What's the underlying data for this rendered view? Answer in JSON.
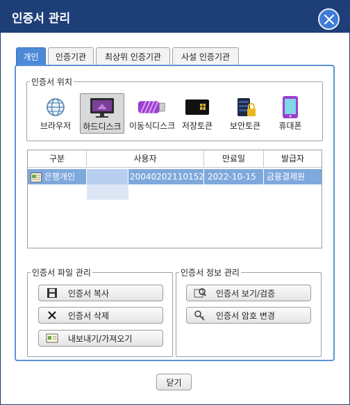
{
  "window": {
    "title": "인증서 관리",
    "close_label": "×"
  },
  "tabs": [
    {
      "label": "개인",
      "active": true
    },
    {
      "label": "인증기관"
    },
    {
      "label": "최상위 인증기관"
    },
    {
      "label": "사설 인증기관"
    }
  ],
  "location": {
    "legend": "인증서 위치",
    "items": [
      {
        "label": "브라우저",
        "icon": "globe-icon"
      },
      {
        "label": "하드디스크",
        "icon": "monitor-icon",
        "selected": true
      },
      {
        "label": "이동식디스크",
        "icon": "usb-drive-icon"
      },
      {
        "label": "저장토큰",
        "icon": "token-icon"
      },
      {
        "label": "보안토큰",
        "icon": "secure-token-icon"
      },
      {
        "label": "휴대폰",
        "icon": "phone-icon"
      }
    ]
  },
  "certs": {
    "headers": [
      "구분",
      "사용자",
      "만료일",
      "발급자"
    ],
    "rows": [
      {
        "type": "은행개인",
        "user": "",
        "serial": "20040202110152...",
        "expiry": "2022-10-15",
        "issuer": "금융결제원"
      }
    ]
  },
  "file_mgmt": {
    "legend": "인증서 파일 관리",
    "copy": "인증서 복사",
    "delete": "인증서 삭제",
    "export": "내보내기/가져오기"
  },
  "info_mgmt": {
    "legend": "인증서 정보 관리",
    "view": "인증서 보기/검증",
    "password": "인증서 암호 변경"
  },
  "footer": {
    "close": "닫기"
  },
  "colors": {
    "titlebar": "#1e3e78",
    "tab_active": "#4c8ad9",
    "row_selected": "#7fa8dc"
  }
}
